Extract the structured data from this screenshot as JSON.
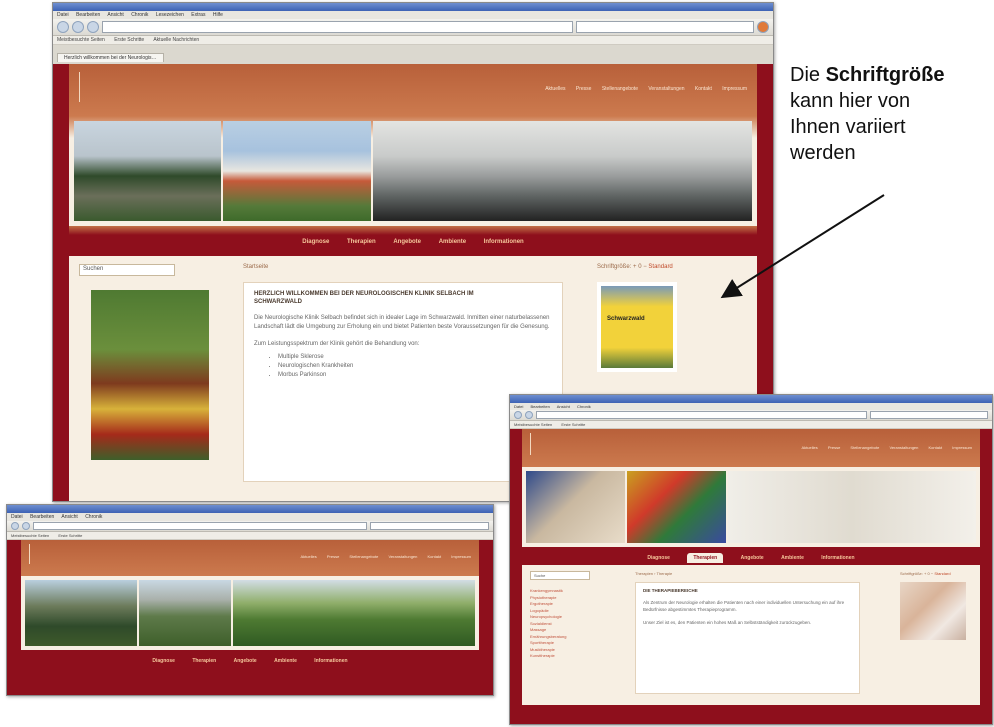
{
  "annotation": {
    "line1_prefix": "Die ",
    "line1_bold": "Schriftgröße",
    "line2": "kann hier von",
    "line3": "Ihnen variiert",
    "line4": "werden"
  },
  "browser_menu": [
    "Datei",
    "Bearbeiten",
    "Ansicht",
    "Chronik",
    "Lesezeichen",
    "Extras",
    "Hilfe"
  ],
  "bookmarks": [
    "Meistbesuchte Seiten",
    "Erste Schritte",
    "Aktuelle Nachrichten"
  ],
  "site_top_nav": [
    "Aktuelles",
    "Presse",
    "Stellenangebote",
    "Veranstaltungen",
    "Kontakt",
    "Impressum"
  ],
  "main_nav": [
    "Diagnose",
    "Therapien",
    "Angebote",
    "Ambiente",
    "Informationen"
  ],
  "window1": {
    "tab_title": "Herzlich willkommen bei der Neurologis…",
    "search_placeholder": "Suchen",
    "breadcrumb": "Startseite",
    "fontsize_label": "Schriftgröße:",
    "fontsize_options": [
      "+",
      "0",
      "−",
      "Standard"
    ],
    "article_title": "HERZLICH WILLKOMMEN BEI DER NEUROLOGISCHEN KLINIK SELBACH IM SCHWARZWALD",
    "paragraph1": "Die Neurologische Klinik Selbach befindet sich in idealer Lage im Schwarzwald. Inmitten einer naturbelassenen Landschaft lädt die Umgebung zur Erholung ein und bietet Patienten beste Voraussetzungen für die Genesung.",
    "paragraph2": "Zum Leistungsspektrum der Klinik gehört die Behandlung von:",
    "list": [
      "Multiple Sklerose",
      "Neurologischen Krankheiten",
      "Morbus Parkinson"
    ],
    "sign_text": "Schwarzwald"
  },
  "window2": {
    "search_placeholder": "Suche",
    "breadcrumb": "Therapien › Therapie",
    "fontsize_label": "Schriftgröße:",
    "fontsize_options": [
      "+",
      "0",
      "−",
      "Standard"
    ],
    "article_title": "DIE THERAPIEBEREICHE",
    "paragraph1": "Als Zentrum der Neurologie erhalten die Patienten nach einer individuellen Untersuchung ein auf ihre Bedürfnisse abgestimmtes Therapieprogramm.",
    "paragraph2": "Unser Ziel ist es, den Patienten ein hohes Maß an Selbstständigkeit zurückzugeben.",
    "side_links": [
      "Krankengymnastik",
      "Physiotherapie",
      "Ergotherapie",
      "Logopädie",
      "Neuropsychologie",
      "Sozialdienst",
      "Massage",
      "Ernährungsberatung",
      "Sporttherapie",
      "Musiktherapie",
      "Kunsttherapie"
    ]
  }
}
